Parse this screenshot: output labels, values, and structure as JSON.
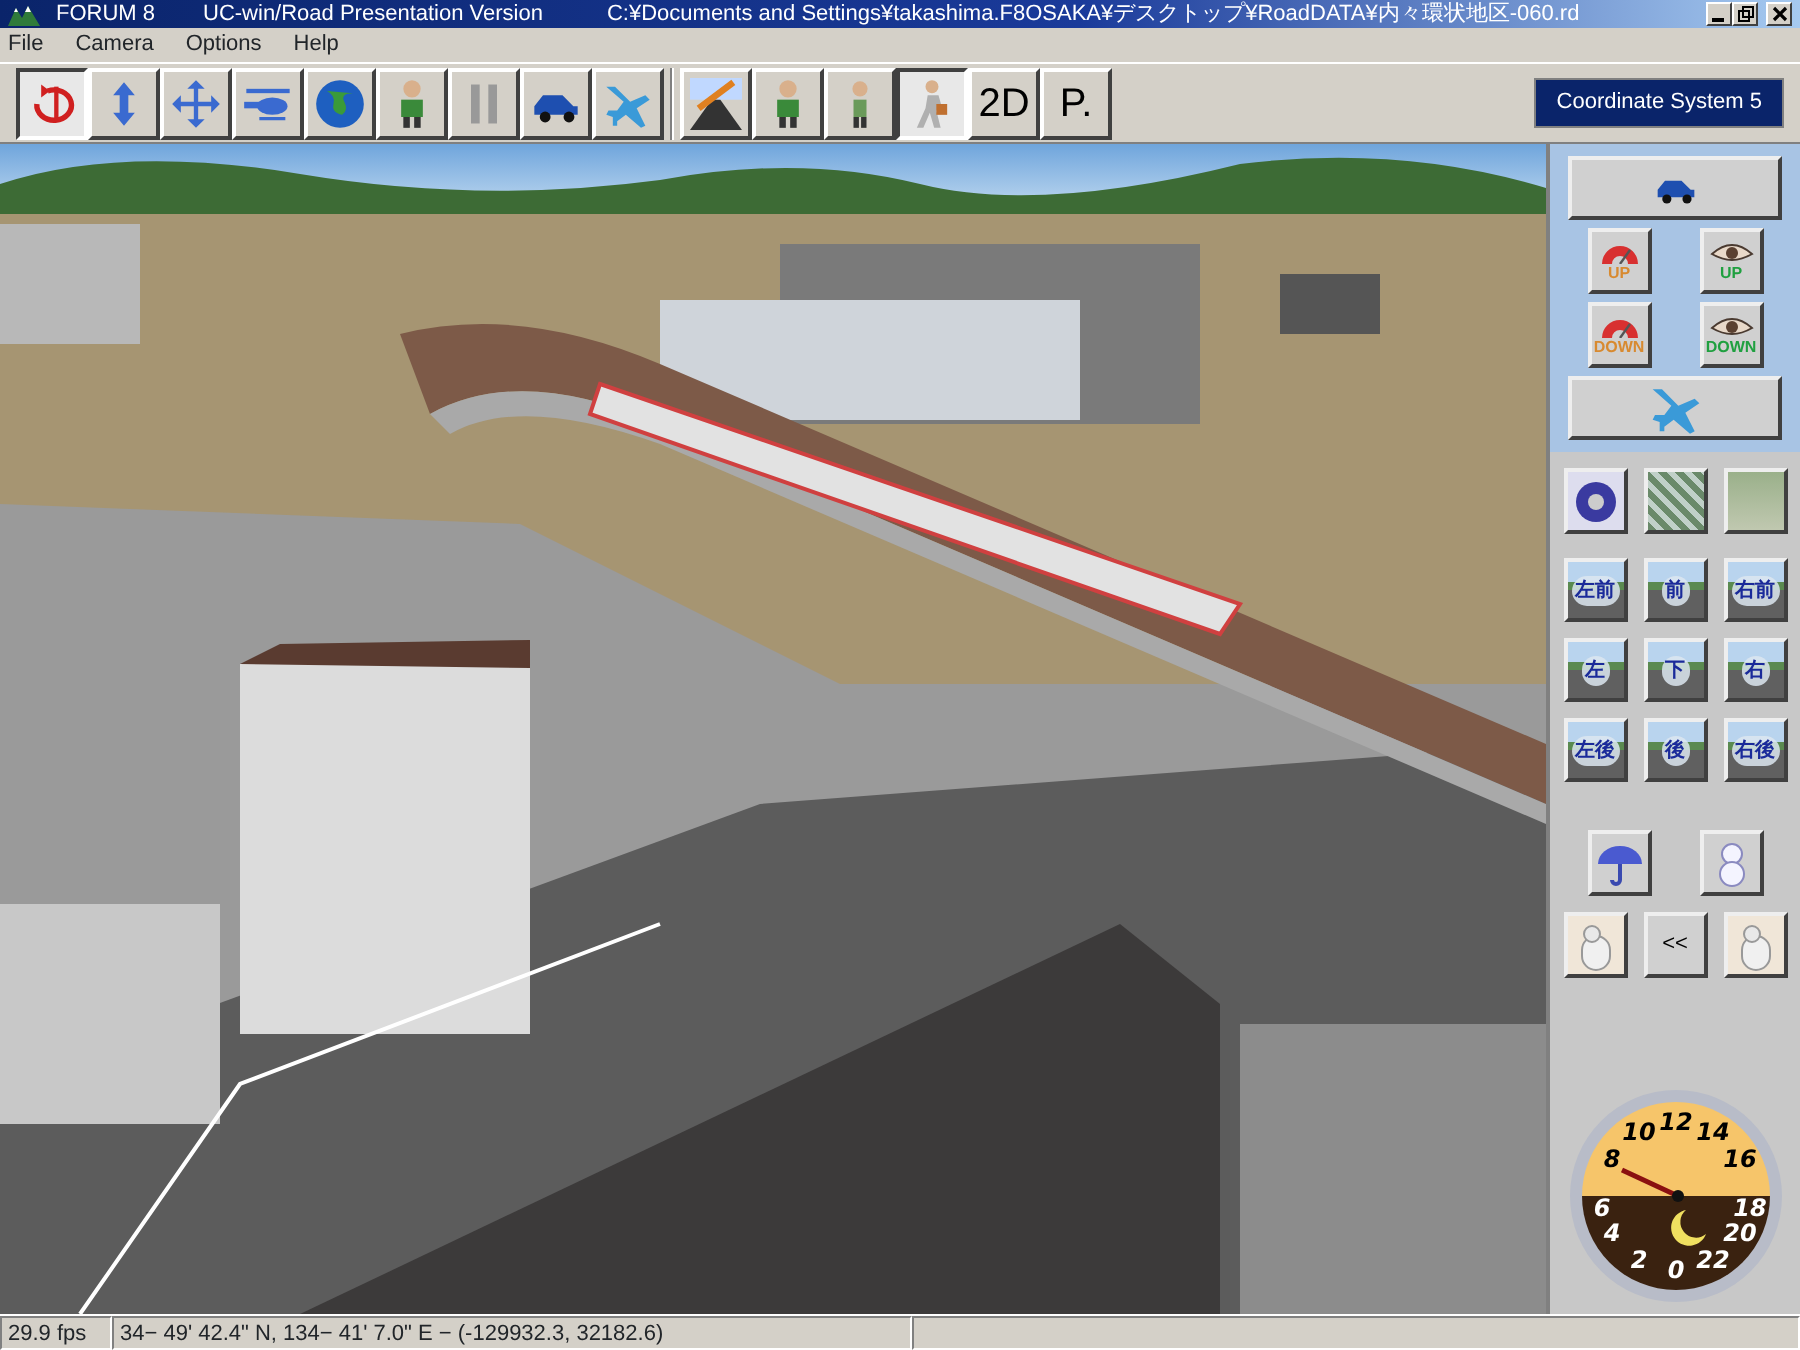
{
  "window": {
    "app": "FORUM 8",
    "title": "UC-win/Road Presentation Version",
    "path": "C:¥Documents and Settings¥takashima.F8OSAKA¥デスクトップ¥RoadDATA¥内々環状地区-060.rd"
  },
  "menu": [
    "File",
    "Camera",
    "Options",
    "Help"
  ],
  "toolbar": [
    {
      "kind": "rotate",
      "selected": true
    },
    {
      "kind": "updown",
      "selected": false
    },
    {
      "kind": "move",
      "selected": false
    },
    {
      "kind": "helicopter",
      "selected": false
    },
    {
      "kind": "globe",
      "selected": false
    },
    {
      "kind": "person",
      "selected": false
    },
    {
      "kind": "pause",
      "selected": false
    },
    {
      "kind": "car",
      "selected": false
    },
    {
      "kind": "plane",
      "selected": false
    },
    {
      "kind": "separator"
    },
    {
      "kind": "roadview",
      "selected": false
    },
    {
      "kind": "person",
      "selected": false
    },
    {
      "kind": "person-narrow",
      "selected": false
    },
    {
      "kind": "walker",
      "selected": true
    },
    {
      "kind": "text",
      "label": "2D",
      "selected": false
    },
    {
      "kind": "text",
      "label": "P.",
      "selected": false
    }
  ],
  "coordinate_system": "Coordinate System 5",
  "panel": {
    "speed_up": "UP",
    "eye_up": "UP",
    "speed_down": "DOWN",
    "eye_down": "DOWN",
    "thumbnails": [
      {
        "kind": "steering"
      },
      {
        "kind": "texture"
      },
      {
        "kind": "terrain"
      }
    ],
    "views": [
      "左前",
      "前",
      "右前",
      "左",
      "下",
      "右",
      "左後",
      "後",
      "右後"
    ],
    "weather": [
      {
        "kind": "umbrella"
      },
      {
        "kind": "snowman"
      }
    ],
    "collapse": "<<"
  },
  "clock": {
    "labels": [
      "0",
      "2",
      "4",
      "6",
      "8",
      "10",
      "12",
      "14",
      "16",
      "18",
      "20",
      "22"
    ]
  },
  "status_bar": {
    "fps": "29.9 fps",
    "position": "34− 49' 42.4\" N, 134− 41' 7.0\" E  −  (-129932.3, 32182.6)"
  }
}
